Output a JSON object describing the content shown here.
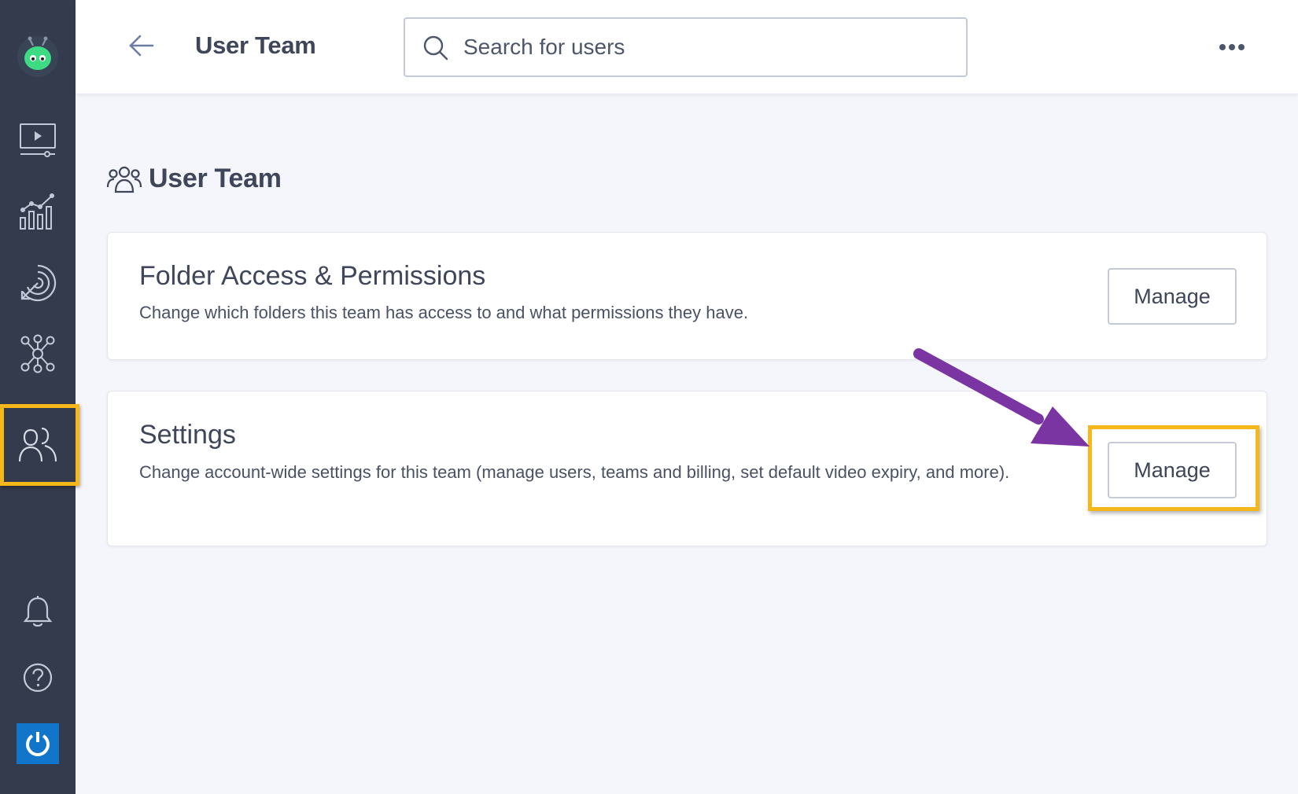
{
  "header": {
    "title": "User Team",
    "search_placeholder": "Search for users"
  },
  "main": {
    "heading": "User Team",
    "cards": [
      {
        "title": "Folder Access & Permissions",
        "description": "Change which folders this team has access to and what permissions they have.",
        "button_label": "Manage"
      },
      {
        "title": "Settings",
        "description": "Change account-wide settings for this team (manage users, teams and billing, set default video expiry, and more).",
        "button_label": "Manage"
      }
    ]
  },
  "sidebar": {
    "items": [
      {
        "icon": "robot-logo-icon"
      },
      {
        "icon": "video-library-icon"
      },
      {
        "icon": "analytics-chart-icon"
      },
      {
        "icon": "target-icon"
      },
      {
        "icon": "integrations-network-icon"
      },
      {
        "icon": "users-team-icon",
        "highlighted": true
      },
      {
        "icon": "bell-icon"
      },
      {
        "icon": "help-icon"
      },
      {
        "icon": "power-icon"
      }
    ]
  },
  "colors": {
    "sidebar_bg": "#343b4d",
    "highlight": "#f5b71a",
    "arrow": "#7b35a3",
    "logo_green": "#3ddc84",
    "power_blue": "#1176c9"
  }
}
